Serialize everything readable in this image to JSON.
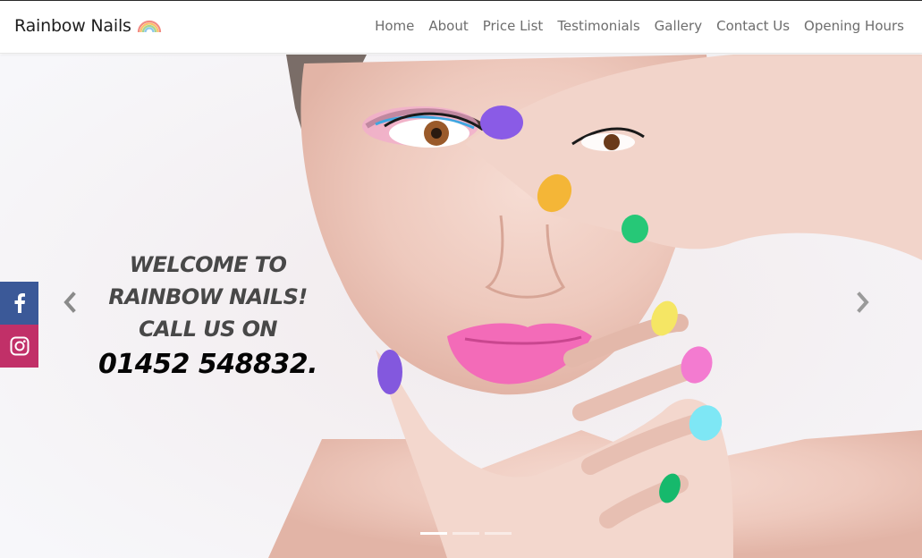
{
  "brand": {
    "name": "Rainbow Nails",
    "icon": "rainbow-icon"
  },
  "nav": {
    "items": [
      {
        "label": "Home"
      },
      {
        "label": "About"
      },
      {
        "label": "Price List"
      },
      {
        "label": "Testimonials"
      },
      {
        "label": "Gallery"
      },
      {
        "label": "Contact Us"
      },
      {
        "label": "Opening Hours"
      }
    ]
  },
  "hero": {
    "line1": "WELCOME TO",
    "line2": "RAINBOW NAILS!",
    "line3": "CALL US ON",
    "phone": "01452 548832.",
    "slide_count": 3,
    "active_slide": 1,
    "image": "woman-with-rainbow-nails"
  },
  "social": [
    {
      "icon": "facebook-icon",
      "color": "#3b5998"
    },
    {
      "icon": "instagram-icon",
      "color": "#c13068"
    }
  ],
  "colors": {
    "text_dark": "#1e1e1e",
    "nav_text": "#6d6d6d",
    "caption_gray": "#484848",
    "phone_black": "#050505"
  }
}
